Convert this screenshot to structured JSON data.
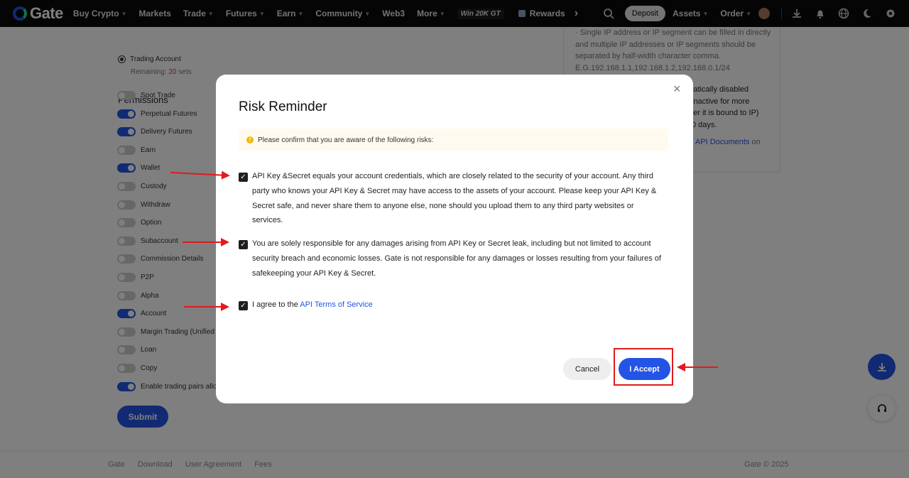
{
  "nav": {
    "logo_text": "Gate",
    "items": [
      {
        "label": "Buy Crypto",
        "chevron": true
      },
      {
        "label": "Markets",
        "chevron": false
      },
      {
        "label": "Trade",
        "chevron": true
      },
      {
        "label": "Futures",
        "chevron": true
      },
      {
        "label": "Earn",
        "chevron": true
      },
      {
        "label": "Community",
        "chevron": true
      },
      {
        "label": "Web3",
        "chevron": false
      },
      {
        "label": "More",
        "chevron": true
      }
    ],
    "promo_label": "Win 20K GT",
    "rewards_label": "Rewards",
    "more_arrow": "›",
    "deposit_label": "Deposit",
    "assets_label": "Assets",
    "order_label": "Order"
  },
  "background": {
    "trading_account_label": "Trading Account",
    "remaining_prefix": "Remaining: ",
    "remaining_count": "20",
    "remaining_suffix": " sets",
    "permissions_title": "Permissions",
    "permissions": [
      {
        "label": "Spot Trade",
        "enabled": false
      },
      {
        "label": "Perpetual Futures",
        "enabled": true
      },
      {
        "label": "Delivery Futures",
        "enabled": true
      },
      {
        "label": "Earn",
        "enabled": false
      },
      {
        "label": "Wallet",
        "enabled": true
      },
      {
        "label": "Custody",
        "enabled": false
      },
      {
        "label": "Withdraw",
        "enabled": false
      },
      {
        "label": "Option",
        "enabled": false
      },
      {
        "label": "Subaccount",
        "enabled": false
      },
      {
        "label": "Commission Details",
        "enabled": false
      },
      {
        "label": "P2P",
        "enabled": false
      },
      {
        "label": "Alpha",
        "enabled": false
      },
      {
        "label": "Account",
        "enabled": true
      },
      {
        "label": "Margin Trading (Unified A",
        "enabled": false
      },
      {
        "label": "Loan",
        "enabled": false
      },
      {
        "label": "Copy",
        "enabled": false
      },
      {
        "label": "Enable trading pairs allov",
        "enabled": true
      }
    ],
    "submit_label": "Submit",
    "right_card": {
      "ip_note": "· Single IP address or IP segment can be filled in directly and multiple IP addresses or IP segments should be separated by half-width character comma. E.G.192.168.1.1,192.168.1.2,192.168.0.1/24",
      "disable_note_1": "tomatically disabled",
      "disable_note_2": "inactive for more",
      "disable_note_3": "her it is bound to IP)",
      "disable_note_4": "0 days.",
      "docs_link": "API Documents",
      "docs_suffix": " on"
    }
  },
  "footer": {
    "links": [
      "Gate",
      "Download",
      "User Agreement",
      "Fees"
    ],
    "copyright": "Gate © 2025"
  },
  "modal": {
    "title": "Risk Reminder",
    "close_glyph": "×",
    "notice": "Please confirm that you are aware of the following risks:",
    "checks": [
      {
        "text": "API Key &Secret equals your account credentials, which are closely related to the security of your account. Any third party who knows your API Key & Secret may have access to the assets of your account. Please keep your API Key & Secret safe, and never share them to anyone else, none should you upload them to any third party websites or services.",
        "checked": true
      },
      {
        "text": "You are solely responsible for any damages arising from API Key or Secret leak, including but not limited to account security breach and economic losses. Gate is not responsible for any damages or losses resulting from your failures of safekeeping your API Key & Secret.",
        "checked": true
      },
      {
        "text_prefix": "I agree to the ",
        "link": "API Terms of Service",
        "checked": true
      }
    ],
    "cancel_label": "Cancel",
    "accept_label": "I Accept"
  },
  "colors": {
    "brand_blue": "#2354e6",
    "annotation_red": "#e21b1b",
    "nav_bg": "#0a0a0a"
  },
  "icons": [
    "search-icon",
    "download-icon",
    "bell-icon",
    "globe-icon",
    "moon-icon",
    "gear-icon",
    "close-icon",
    "warning-icon",
    "checkbox-check-icon",
    "headset-icon"
  ]
}
